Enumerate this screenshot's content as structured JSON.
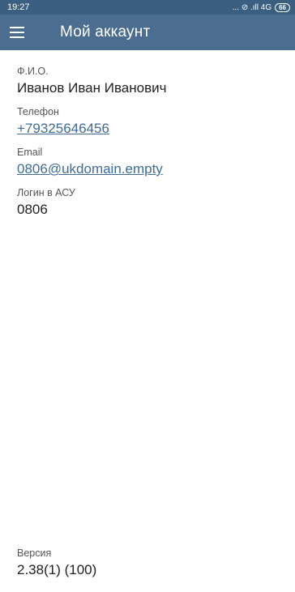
{
  "status_bar": {
    "time": "19:27",
    "indicators": "... ⊘ .ıll 4G",
    "battery": "66"
  },
  "app_bar": {
    "menu_icon": "hamburger-menu-icon",
    "title": "Мой аккаунт"
  },
  "account": {
    "name_label": "Ф.И.О.",
    "name_value": "Иванов Иван Иванович",
    "phone_label": "Телефон",
    "phone_value": "+79325646456",
    "email_label": "Email",
    "email_value": "0806@ukdomain.empty",
    "login_label": "Логин в АСУ",
    "login_value": "0806"
  },
  "footer": {
    "version_label": "Версия",
    "version_value": "2.38(1) (100)"
  },
  "colors": {
    "status_bar": "#3b5f80",
    "app_bar": "#4a6d90",
    "link": "#3f6b97"
  }
}
